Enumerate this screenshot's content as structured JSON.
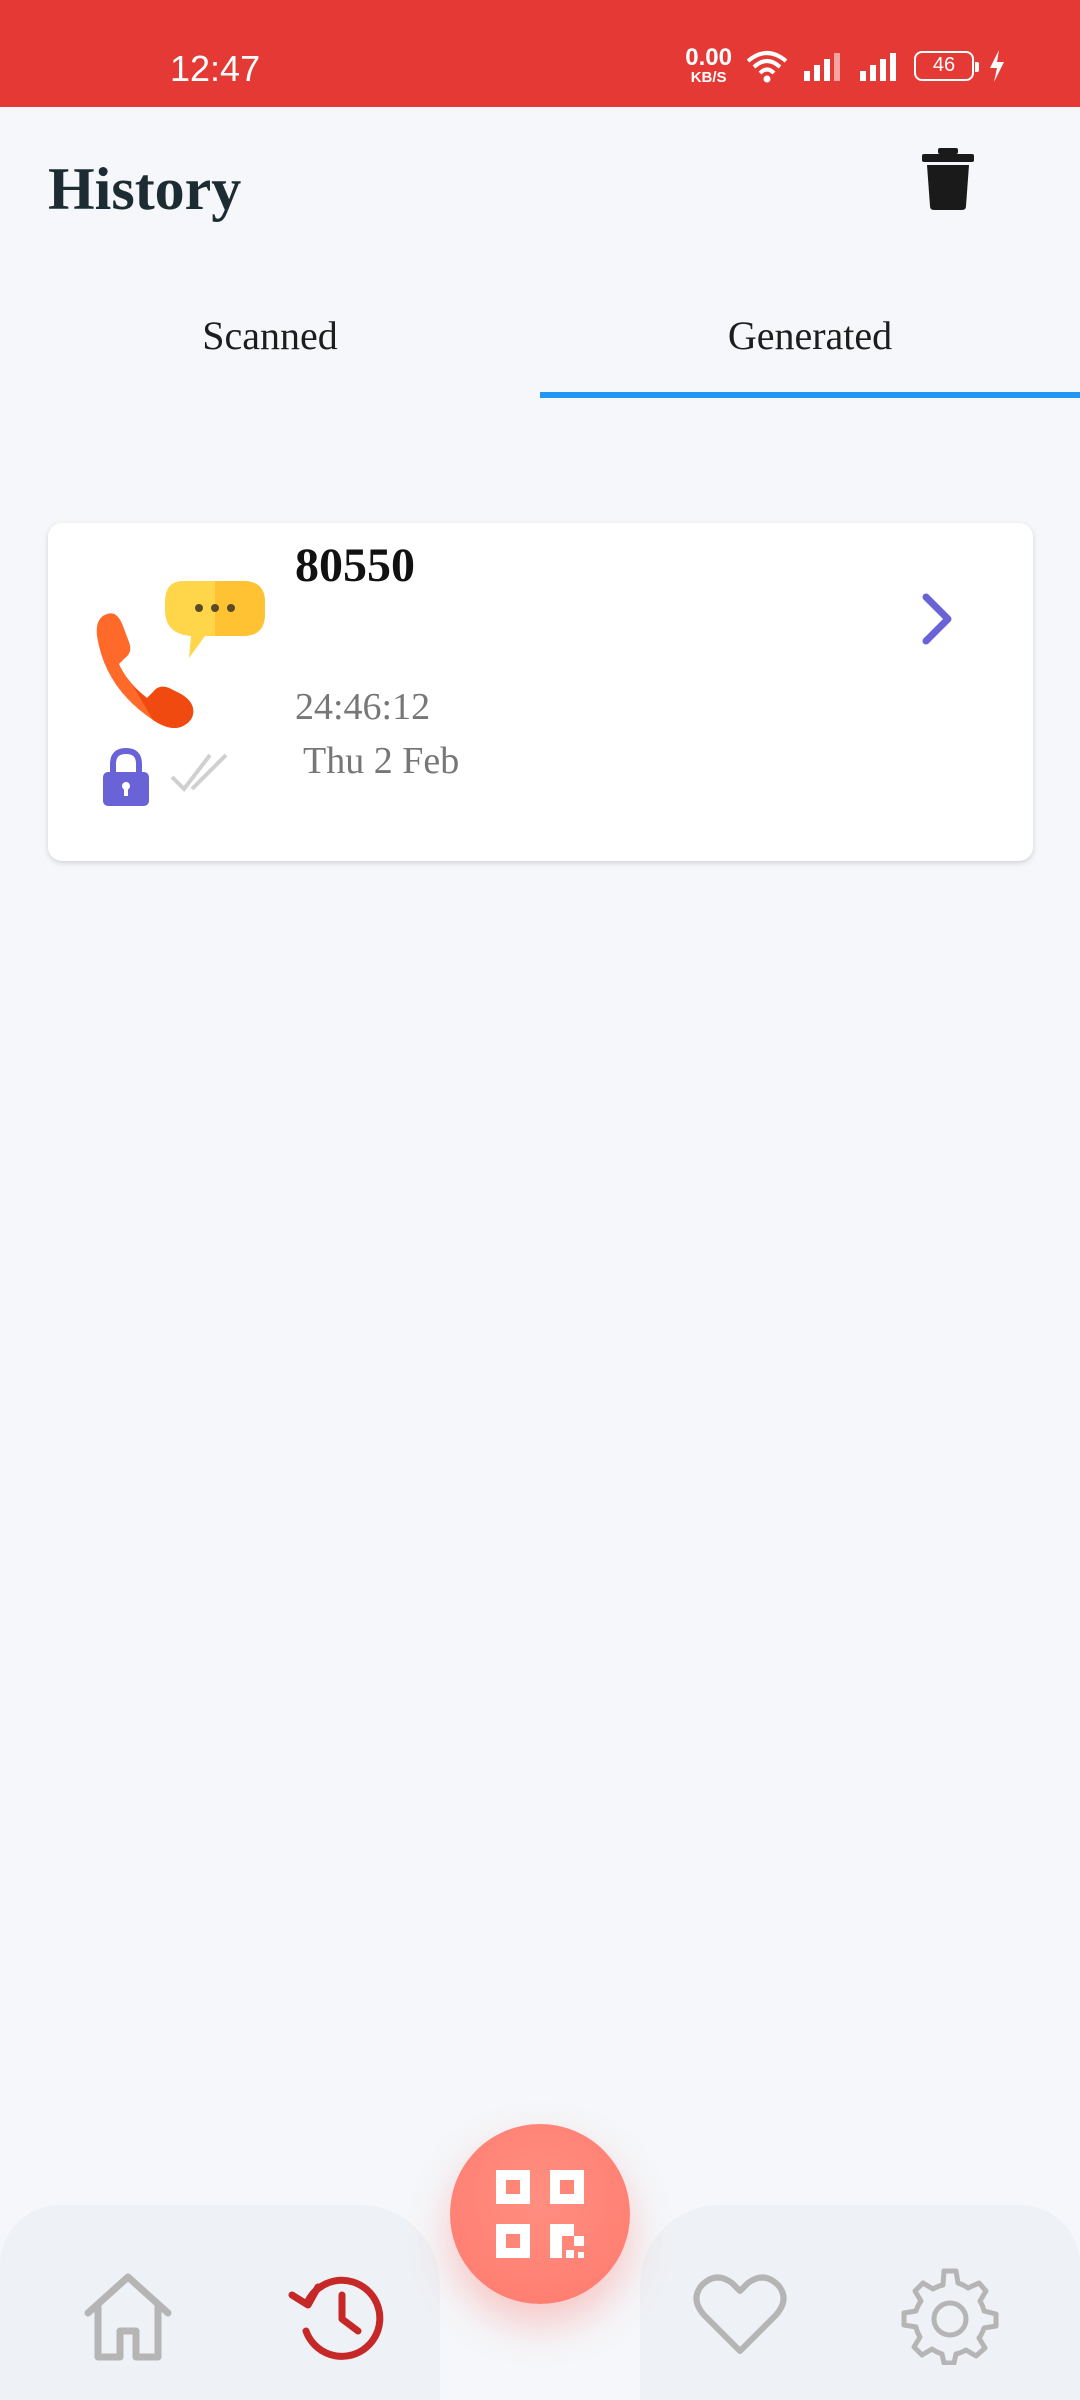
{
  "status_bar": {
    "time": "12:47",
    "net_speed_value": "0.00",
    "net_speed_unit": "KB/S",
    "battery": "46"
  },
  "header": {
    "title": "History"
  },
  "tabs": [
    {
      "label": "Scanned",
      "active": false
    },
    {
      "label": "Generated",
      "active": true
    }
  ],
  "history_items": [
    {
      "title": "80550",
      "time": "24:46:12",
      "date": "Thu 2 Feb",
      "type_icon": "phone-message-icon"
    }
  ],
  "colors": {
    "status_bar": "#e53935",
    "tab_indicator": "#2196f3",
    "fab": "#ff7a6e",
    "accent_purple": "#6a63d8",
    "active_nav": "#c62828"
  }
}
